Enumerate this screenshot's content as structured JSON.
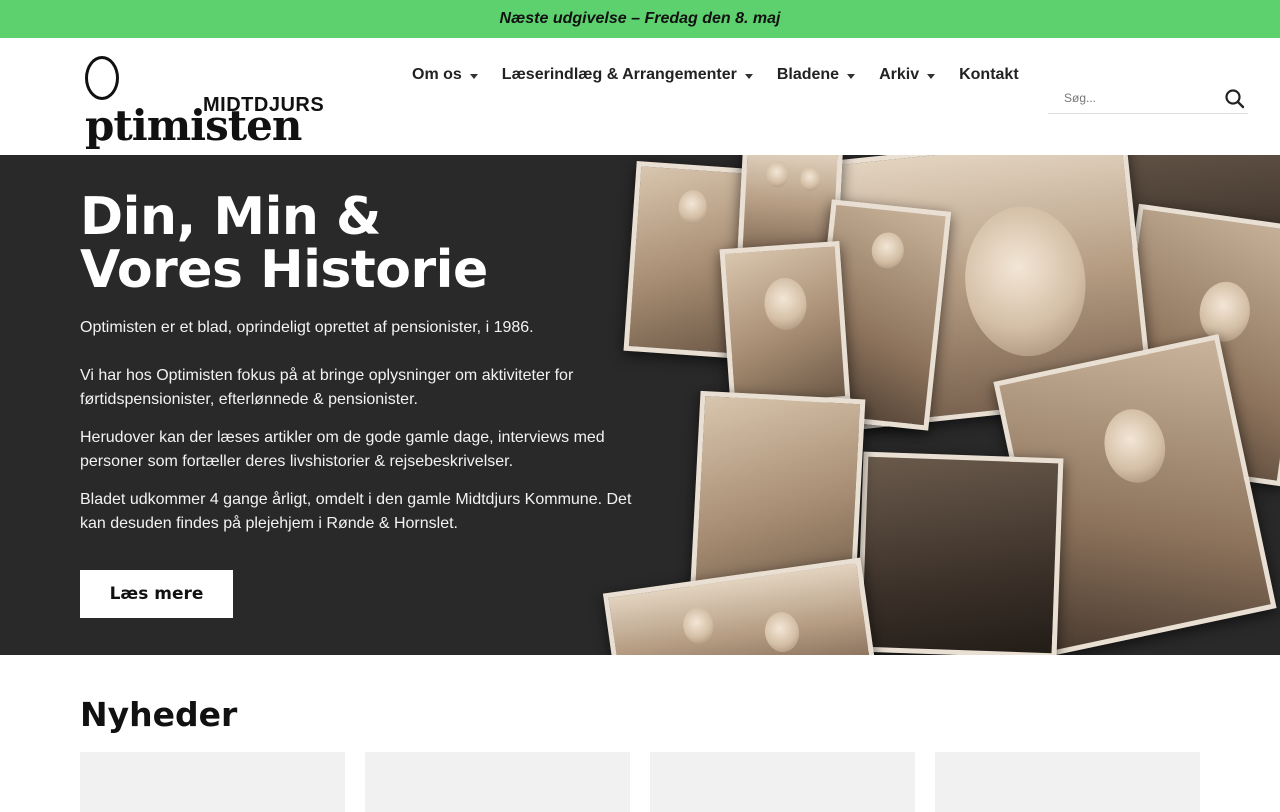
{
  "announcement": "Næste udgivelse – Fredag den 8. maj",
  "logo": {
    "main": "ptimisten",
    "sub": "MIDTDJURS"
  },
  "nav": [
    {
      "label": "Om os",
      "dropdown": true
    },
    {
      "label": "Læserindlæg & Arrangementer",
      "dropdown": true
    },
    {
      "label": "Bladene",
      "dropdown": true
    },
    {
      "label": "Arkiv",
      "dropdown": true
    },
    {
      "label": "Kontakt",
      "dropdown": false
    }
  ],
  "search": {
    "placeholder": "Søg...",
    "icon": "search-icon"
  },
  "hero": {
    "title_line1": "Din, Min &",
    "title_line2": "Vores Historie",
    "paragraphs": [
      "Optimisten er et blad, oprindeligt oprettet af pensionister, i 1986.",
      "Vi har hos Optimisten fokus på at bringe oplysninger om aktiviteter for førtidspensionister, efterlønnede & pensionister.",
      "Herudover kan der læses artikler om de gode gamle dage, interviews med personer som fortæller deres livshistorier & rejsebeskrivelser.",
      "Bladet udkommer 4 gange årligt, omdelt i den gamle Midtdjurs Kommune. Det kan desuden findes på plejehjem i Rønde & Hornslet."
    ],
    "button": "Læs mere"
  },
  "news": {
    "heading": "Nyheder",
    "card_count": 4
  },
  "colors": {
    "announcement_bg": "#5ed16f",
    "hero_bg": "#292929"
  }
}
